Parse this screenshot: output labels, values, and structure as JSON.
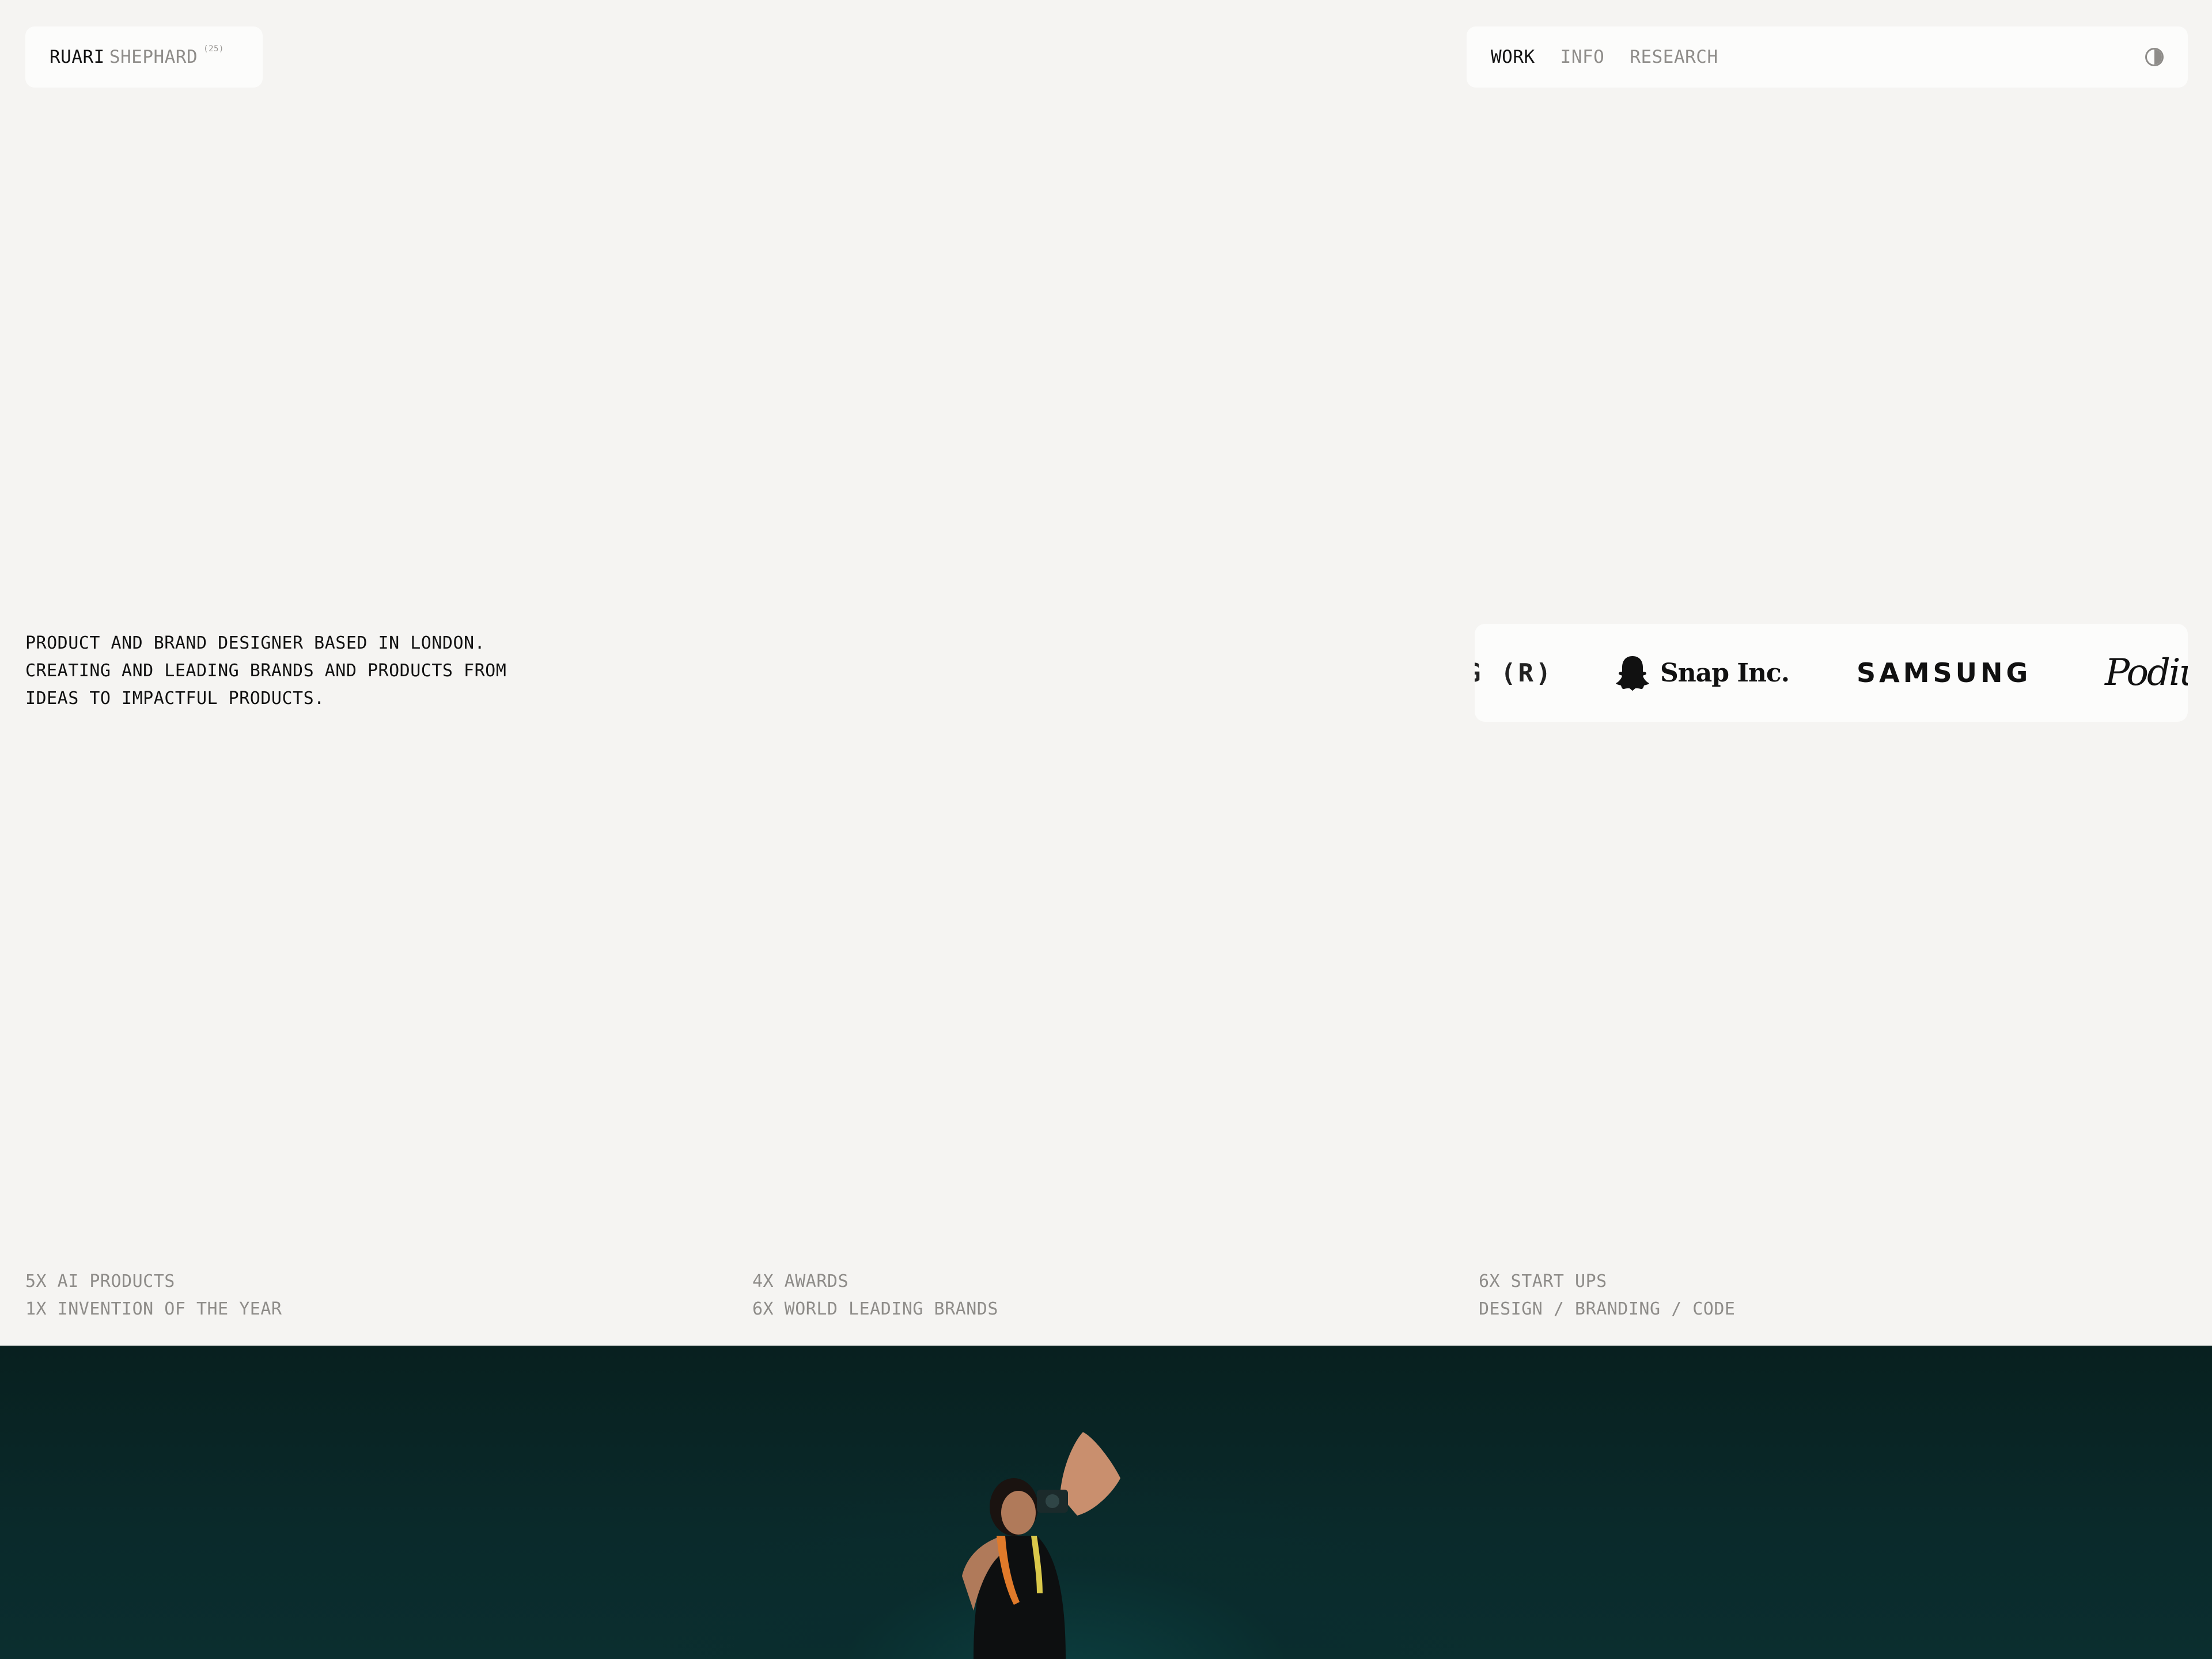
{
  "header": {
    "first_name": "RUARI",
    "last_name": "SHEPHARD",
    "year": "(25)"
  },
  "nav": {
    "items": [
      {
        "label": "WORK",
        "active": true
      },
      {
        "label": "INFO",
        "active": false
      },
      {
        "label": "RESEARCH",
        "active": false
      }
    ],
    "theme_toggle_icon": "contrast-icon"
  },
  "intro": {
    "lines": [
      "PRODUCT AND BRAND DESIGNER BASED IN LONDON.",
      "CREATING AND LEADING BRANDS AND PRODUCTS FROM",
      "IDEAS TO IMPACTFUL PRODUCTS."
    ]
  },
  "logos": {
    "partial": "G (R)",
    "snap": "Snap Inc.",
    "samsung": "SAMSUNG",
    "script": "Podium"
  },
  "stats": [
    {
      "line1": "5X AI PRODUCTS",
      "line2": "1X INVENTION OF THE YEAR"
    },
    {
      "line1": "4X AWARDS",
      "line2": "6X WORLD LEADING BRANDS"
    },
    {
      "line1": "6X START UPS",
      "line2": "DESIGN / BRANDING / CODE"
    }
  ],
  "colors": {
    "background": "#f5f4f2",
    "pill": "#fcfcfb",
    "text": "#111111",
    "muted": "#8e8c89",
    "hero": "#0a2a2b"
  }
}
